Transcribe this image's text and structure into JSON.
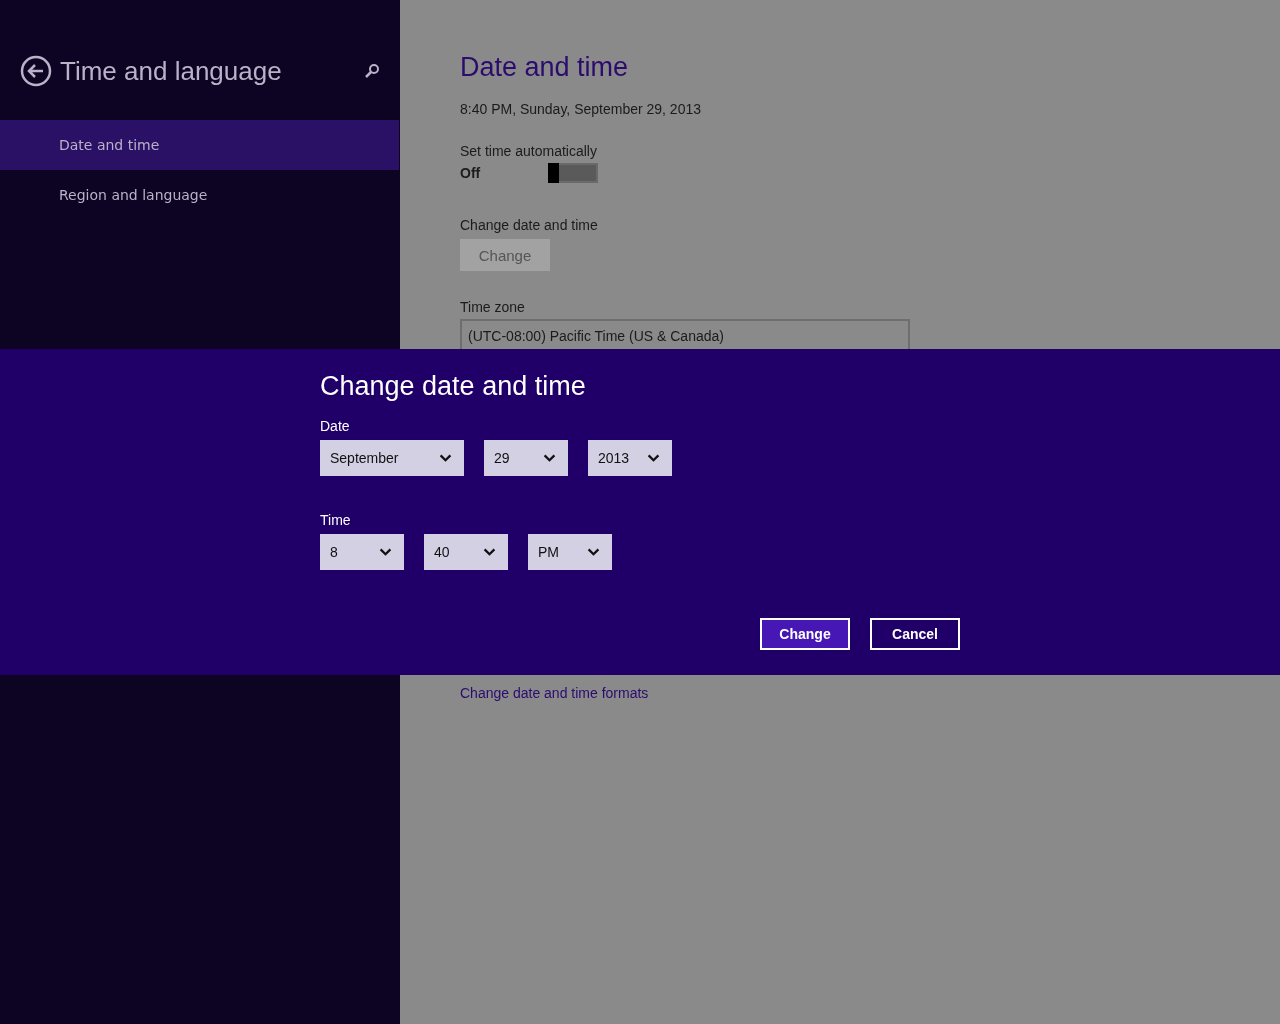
{
  "sidebar": {
    "title": "Time and language",
    "items": [
      {
        "label": "Date and time",
        "selected": true
      },
      {
        "label": "Region and language",
        "selected": false
      }
    ]
  },
  "page": {
    "title": "Date and time",
    "current": "8:40 PM, Sunday, September 29, 2013",
    "auto_time": {
      "label": "Set time automatically",
      "state": "Off",
      "on": false
    },
    "change": {
      "label": "Change date and time",
      "button": "Change",
      "disabled": true
    },
    "time_zone": {
      "label": "Time zone",
      "value": "(UTC-08:00) Pacific Time (US & Canada)"
    },
    "formats_link": "Change date and time formats"
  },
  "dialog": {
    "title": "Change date and time",
    "groups": [
      {
        "label": "Date",
        "fields": [
          {
            "value": "September",
            "wide": true
          },
          {
            "value": "29",
            "wide": false
          },
          {
            "value": "2013",
            "wide": false
          }
        ]
      },
      {
        "label": "Time",
        "fields": [
          {
            "value": "8",
            "wide": false
          },
          {
            "value": "40",
            "wide": false
          },
          {
            "value": "PM",
            "wide": false
          }
        ]
      }
    ],
    "buttons": [
      {
        "label": "Change",
        "primary": true
      },
      {
        "label": "Cancel",
        "primary": false
      }
    ]
  }
}
